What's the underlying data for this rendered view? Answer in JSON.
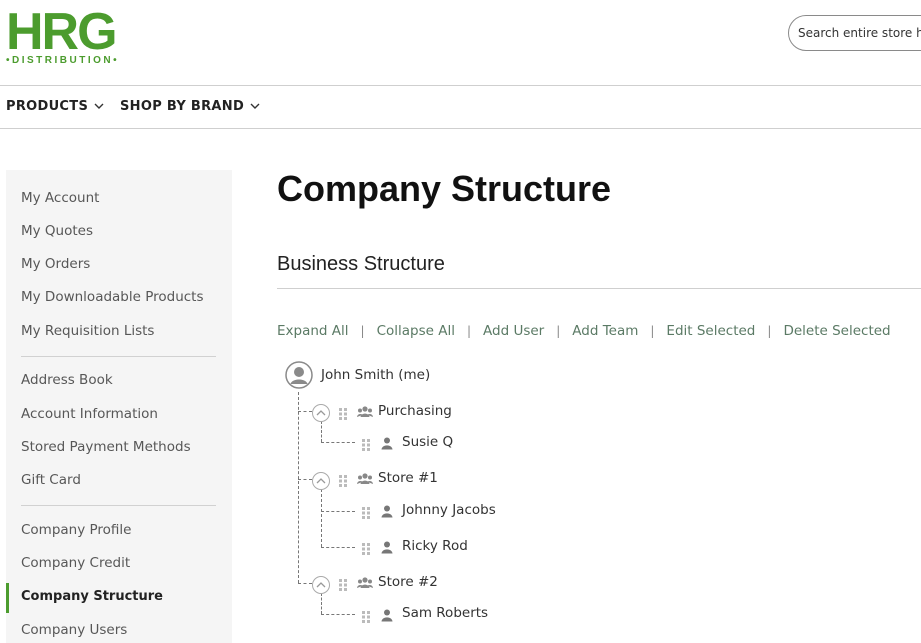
{
  "header": {
    "logo_text": "HRG",
    "logo_subtext": "•DISTRIBUTION•",
    "search_placeholder": "Search entire store here..."
  },
  "nav": {
    "items": [
      {
        "label": "PRODUCTS"
      },
      {
        "label": "SHOP BY BRAND"
      }
    ]
  },
  "sidebar": {
    "items": [
      {
        "label": "My Account"
      },
      {
        "label": "My Quotes"
      },
      {
        "label": "My Orders"
      },
      {
        "label": "My Downloadable Products"
      },
      {
        "label": "My Requisition Lists"
      },
      {
        "label": "Address Book"
      },
      {
        "label": "Account Information"
      },
      {
        "label": "Stored Payment Methods"
      },
      {
        "label": "Gift Card"
      },
      {
        "label": "Company Profile"
      },
      {
        "label": "Company Credit"
      },
      {
        "label": "Company Structure"
      },
      {
        "label": "Company Users"
      }
    ],
    "active": "Company Structure"
  },
  "main": {
    "title": "Company Structure",
    "section_title": "Business Structure",
    "actions": [
      {
        "label": "Expand All"
      },
      {
        "label": "Collapse All"
      },
      {
        "label": "Add User"
      },
      {
        "label": "Add Team"
      },
      {
        "label": "Edit Selected"
      },
      {
        "label": "Delete Selected"
      }
    ]
  },
  "tree": {
    "root": {
      "label": "John Smith (me)"
    },
    "teams": [
      {
        "label": "Purchasing",
        "members": [
          {
            "label": "Susie Q"
          }
        ]
      },
      {
        "label": "Store #1",
        "members": [
          {
            "label": "Johnny Jacobs"
          },
          {
            "label": "Ricky Rod"
          }
        ]
      },
      {
        "label": "Store #2",
        "members": [
          {
            "label": "Sam Roberts"
          }
        ]
      }
    ]
  },
  "colors": {
    "brand_green": "#4c9c2e",
    "link": "#5b7a65",
    "sidebar_bg": "#f5f5f5"
  }
}
